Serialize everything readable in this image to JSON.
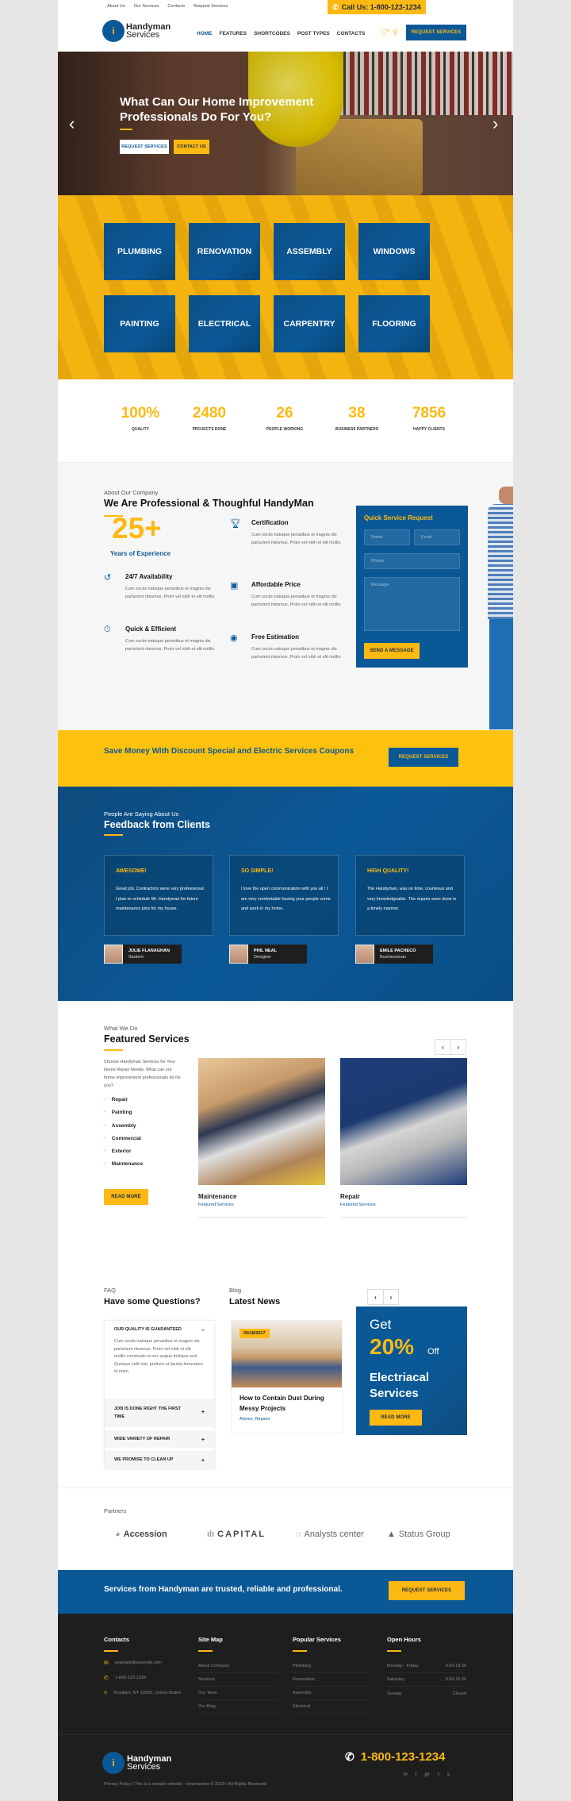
{
  "topbar": {
    "links": [
      "About Us",
      "Our Services",
      "Contacts",
      "Request Services"
    ],
    "call_label": "Call Us: 1-800-123-1234",
    "phone_icon": "phone-icon"
  },
  "header": {
    "logo_line1": "Handyman",
    "logo_line2": "Services",
    "nav": [
      "HOME",
      "FEATURES",
      "SHORTCODES",
      "POST TYPES",
      "CONTACTS"
    ],
    "active_nav": "HOME",
    "cart_count": "0",
    "request_button": "REQUEST SERVICES"
  },
  "hero": {
    "title": "What Can Our Home Improvement Professionals Do For You?",
    "btn_request": "REQUEST SERVICES",
    "btn_contact": "CONTACT US",
    "prev_icon": "‹",
    "next_icon": "›"
  },
  "services": [
    "PLUMBING",
    "RENOVATION",
    "ASSEMBLY",
    "WINDOWS",
    "PAINTING",
    "ELECTRICAL",
    "CARPENTRY",
    "FLOORING"
  ],
  "stats": [
    {
      "value": "100%",
      "label": "QUALITY"
    },
    {
      "value": "2480",
      "label": "PROJECTS DONE"
    },
    {
      "value": "26",
      "label": "PEOPLE WORKING"
    },
    {
      "value": "38",
      "label": "BUSINESS PARTNERS"
    },
    {
      "value": "7856",
      "label": "HAPPY CLIENTS"
    }
  ],
  "about": {
    "subtitle": "About Our Company",
    "title": "We Are Professional & Thoughful HandyMan",
    "years": "25+",
    "years_label": "Years of Experience",
    "features": [
      {
        "title": "Certification",
        "icon": "trophy-icon",
        "text": "Cum sociis natoque penatibus et magnis dis parturient ntesmus. Proin vel nibh et elit mollis"
      },
      {
        "title": "24/7 Availability",
        "icon": "history-icon",
        "text": "Cum sociis natoque penatibus et magnis dis parturient ntesmus. Proin vel nibh et elit mollis"
      },
      {
        "title": "Affordable Price",
        "icon": "wallet-icon",
        "text": "Cum sociis natoque penatibus et magnis dis parturient ntesmus. Proin vel nibh et elit mollis"
      },
      {
        "title": "Quick & Efficient",
        "icon": "stopwatch-icon",
        "text": "Cum sociis natoque penatibus et magnis dis parturient ntesmus. Proin vel nibh et elit mollis"
      },
      {
        "title": "Free Estimation",
        "icon": "eye-icon",
        "text": "Cum sociis natoque penatibus et magnis dis parturient ntesmus. Proin vel nibh et elit mollis"
      }
    ],
    "form": {
      "title": "Quick Service Request",
      "name_placeholder": "Name",
      "email_placeholder": "Email",
      "phone_placeholder": "Phone",
      "message_placeholder": "Message",
      "submit": "SEND A MESSAGE"
    }
  },
  "discount": {
    "text": "Save Money With Discount Special and Electric Services Coupons",
    "button": "REQUEST SERVICES"
  },
  "feedback": {
    "subtitle": "People Are Saying About Us",
    "title": "Feedback from Clients",
    "items": [
      {
        "heading": "AWESOME!",
        "text": "Great job. Contractors were very professional. I plan to schedule Mr. Handyman for future maintenance jobs for my house.",
        "name": "JULIE FLANAGHAN",
        "role": "Student"
      },
      {
        "heading": "SO SIMPLE!",
        "text": "I love the open communication with you all ! I am very comfortable having your people come and work in my home.",
        "name": "PHIL NEAL",
        "role": "Designer"
      },
      {
        "heading": "HIGH QUALITY!",
        "text": "The Handyman, was on time, courteous and very knowledgeable. The repairs were done in a timely manner.",
        "name": "EMILE PACHECO",
        "role": "Businessman"
      }
    ]
  },
  "featured": {
    "subtitle": "What We Do",
    "title": "Featured Services",
    "description": "Choose Handyman Services for Your Home Repair Needs. What can our home improvement professionals do for you?",
    "list": [
      "Repair",
      "Painting",
      "Assembly",
      "Commercial",
      "Exterior",
      "Maintenance"
    ],
    "read_more": "READ MORE",
    "cards": [
      {
        "title": "Maintenance",
        "category": "Featured Services"
      },
      {
        "title": "Repair",
        "category": "Featured Services"
      }
    ]
  },
  "faq": {
    "subtitle": "FAQ",
    "title": "Have some Questions?",
    "items": [
      {
        "q": "OUR QUALITY IS GUARANTEED",
        "open": true,
        "sign": "−",
        "a": "Cum sociis natoque penatibus et magnis dis parturient ntesmus. Proin vel nibh et elit mollis commodo et nec augue tristique sed Quisque velit nisi, pretium ut lacinia lementum id enim."
      },
      {
        "q": "JOB IS DONE RIGHT THE FIRST TIME",
        "open": false,
        "sign": "+"
      },
      {
        "q": "WIDE VARIETY OF REPAIR",
        "open": false,
        "sign": "+"
      },
      {
        "q": "WE PROMISE TO CLEAN UP",
        "open": false,
        "sign": "+"
      }
    ]
  },
  "blog": {
    "subtitle": "Blog",
    "title": "Latest News",
    "post": {
      "date": "05/18/2017",
      "title": "How to Contain Dust During Messy Projects",
      "categories": "Advice, Repairs"
    }
  },
  "promo": {
    "get": "Get",
    "percent": "20%",
    "off": "Off",
    "line1": "Electriacal",
    "line2": "Services",
    "button": "READ MORE"
  },
  "partners": {
    "label": "Partners",
    "logos": [
      "Accession",
      "CAPITAL",
      "Analysts center",
      "Status Group"
    ]
  },
  "trust": {
    "text": "Services from Handyman are trusted, reliable and professional.",
    "button": "REQUEST SERVICES"
  },
  "footer": {
    "contacts_title": "Contacts",
    "email": "example@example.com",
    "phone": "1-800-123-1234",
    "address": "Brooklyn, NY 10036, United States",
    "sitemap_title": "Site Map",
    "sitemap": [
      "About Company",
      "Services",
      "Our Team",
      "Our Blog"
    ],
    "popular_title": "Popular Services",
    "popular": [
      "Plumbing",
      "Renovation",
      "Assembly",
      "Electrical"
    ],
    "hours_title": "Open Hours",
    "hours": [
      {
        "day": "Monday - Friday",
        "time": "9.00-19.00"
      },
      {
        "day": "Saturday",
        "time": "9.00-15.00"
      },
      {
        "day": "Sunday",
        "time": "Closed"
      }
    ],
    "logo_line1": "Handyman",
    "logo_line2": "Services",
    "big_phone": "1-800-123-1234",
    "social": [
      "in",
      "f",
      "g+",
      "t",
      "s"
    ],
    "copyright": "Privacy Policy / This is a sample website - cmsmasters © 2019 / All Rights Reserved"
  },
  "colors": {
    "brand_blue": "#0b5897",
    "brand_yellow": "#fdb913",
    "footer_dark": "#1e1e1e"
  }
}
